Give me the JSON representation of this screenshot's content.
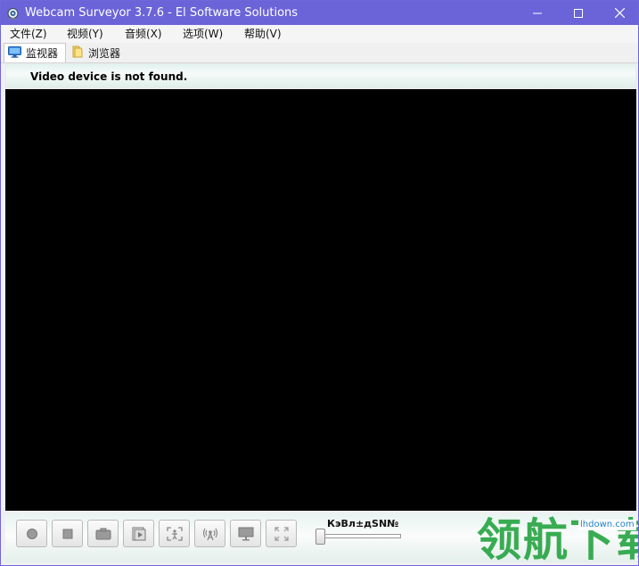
{
  "window": {
    "title": "Webcam Surveyor 3.7.6 - El Software Solutions"
  },
  "menu": [
    {
      "label": "文件(Z)"
    },
    {
      "label": "视频(Y)"
    },
    {
      "label": "音频(X)"
    },
    {
      "label": "选项(W)"
    },
    {
      "label": "帮助(V)"
    }
  ],
  "tabs": [
    {
      "label": "监视器",
      "icon": "monitor-icon",
      "active": true
    },
    {
      "label": "浏览器",
      "icon": "folder-icon",
      "active": false
    }
  ],
  "status": {
    "message": "Video device is not found."
  },
  "controls": {
    "buttons": [
      {
        "icon": "record-icon"
      },
      {
        "icon": "stop-icon"
      },
      {
        "icon": "camera-icon"
      },
      {
        "icon": "playback-icon"
      },
      {
        "icon": "motion-detect-icon"
      },
      {
        "icon": "broadcast-icon"
      },
      {
        "icon": "screen-capture-icon"
      },
      {
        "icon": "fullscreen-icon"
      }
    ],
    "slider_label": "КэВл±дЅN№",
    "slider_value": 0
  },
  "watermark": {
    "text": "领航下载",
    "url": "lhdown.com"
  },
  "colors": {
    "titlebar": "#6b64d8",
    "video_bg": "#000000",
    "watermark": "#2fa84a"
  }
}
